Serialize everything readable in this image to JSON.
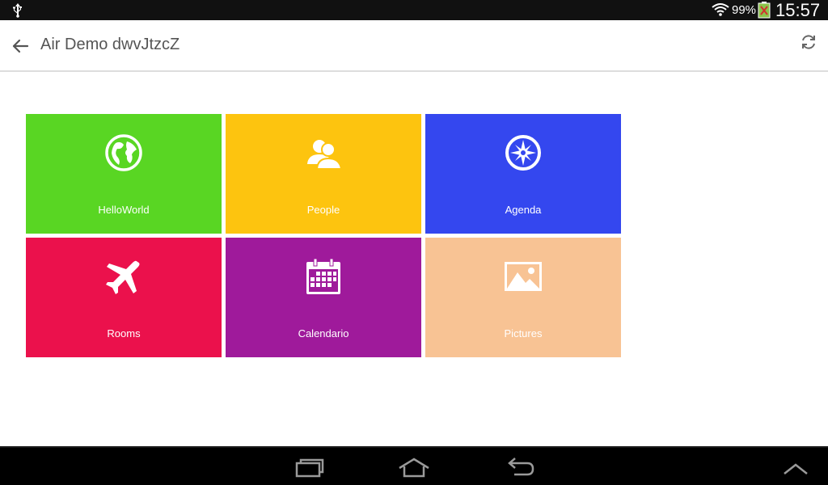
{
  "status_bar": {
    "battery_percent": "99%",
    "time": "15:57",
    "icons": [
      "usb-icon",
      "wifi-icon",
      "battery-charging-icon"
    ]
  },
  "app_bar": {
    "title": "Air Demo dwvJtzcZ",
    "icons": [
      "back-arrow-icon",
      "refresh-icon"
    ]
  },
  "tiles": [
    {
      "label": "HelloWorld",
      "color": "#59d623",
      "icon": "globe-icon"
    },
    {
      "label": "People",
      "color": "#fdc40f",
      "icon": "people-icon"
    },
    {
      "label": "Agenda",
      "color": "#3447ef",
      "icon": "compass-icon"
    },
    {
      "label": "Rooms",
      "color": "#eb114c",
      "icon": "airplane-icon"
    },
    {
      "label": "Calendario",
      "color": "#9f1a9b",
      "icon": "calendar-icon"
    },
    {
      "label": "Pictures",
      "color": "#f8c394",
      "icon": "picture-icon"
    }
  ],
  "nav_bar": {
    "icons": [
      "recent-apps-icon",
      "home-icon",
      "back-icon",
      "up-chevron-icon"
    ]
  }
}
